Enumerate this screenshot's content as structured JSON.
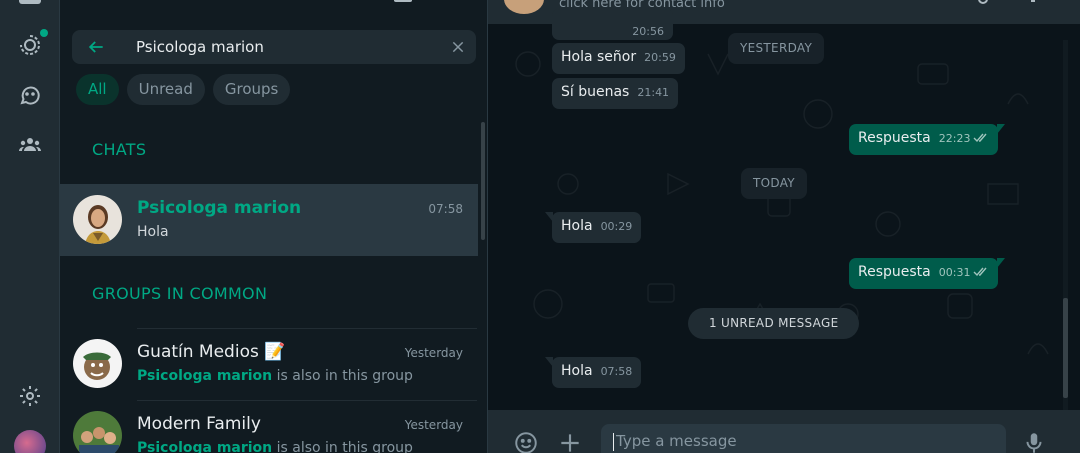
{
  "rail": {
    "icons": [
      "chats-icon",
      "status-icon",
      "channels-icon",
      "communities-icon",
      "settings-icon",
      "profile-avatar"
    ]
  },
  "search": {
    "query": "Psicologa marion"
  },
  "filters": [
    {
      "label": "All",
      "active": true
    },
    {
      "label": "Unread",
      "active": false
    },
    {
      "label": "Groups",
      "active": false
    }
  ],
  "sections": {
    "chats": "CHATS",
    "groups": "GROUPS IN COMMON"
  },
  "chats": [
    {
      "name": "Psicologa marion",
      "time": "07:58",
      "preview": "Hola"
    }
  ],
  "groups": [
    {
      "name": "Guatín Medios 📝",
      "time": "Yesterday",
      "member": "Psicologa marion",
      "rest": " is also in this group"
    },
    {
      "name": "Modern Family",
      "time": "Yesterday",
      "member": "Psicologa marion",
      "rest": " is also in this group"
    }
  ],
  "conversation": {
    "header_info": "click here for contact info",
    "messages": [
      {
        "dir": "in",
        "text": "",
        "time": "20:56"
      },
      {
        "dir": "in",
        "text": "Hola señor",
        "time": "20:59"
      },
      {
        "dir": "in",
        "text": "Sí buenas",
        "time": "21:41"
      },
      {
        "dir": "out",
        "text": "Respuesta",
        "time": "22:23"
      },
      {
        "dir": "in",
        "text": "Hola",
        "time": "00:29"
      },
      {
        "dir": "out",
        "text": "Respuesta",
        "time": "00:31"
      },
      {
        "dir": "in",
        "text": "Hola",
        "time": "07:58"
      }
    ],
    "date_labels": {
      "yesterday": "YESTERDAY",
      "today": "TODAY"
    },
    "unread_label": "1 UNREAD MESSAGE"
  },
  "composer": {
    "placeholder": "Type a message"
  },
  "colors": {
    "accent": "#00a884",
    "outgoing_bubble": "#005c4b",
    "incoming_bubble": "#202c33"
  }
}
